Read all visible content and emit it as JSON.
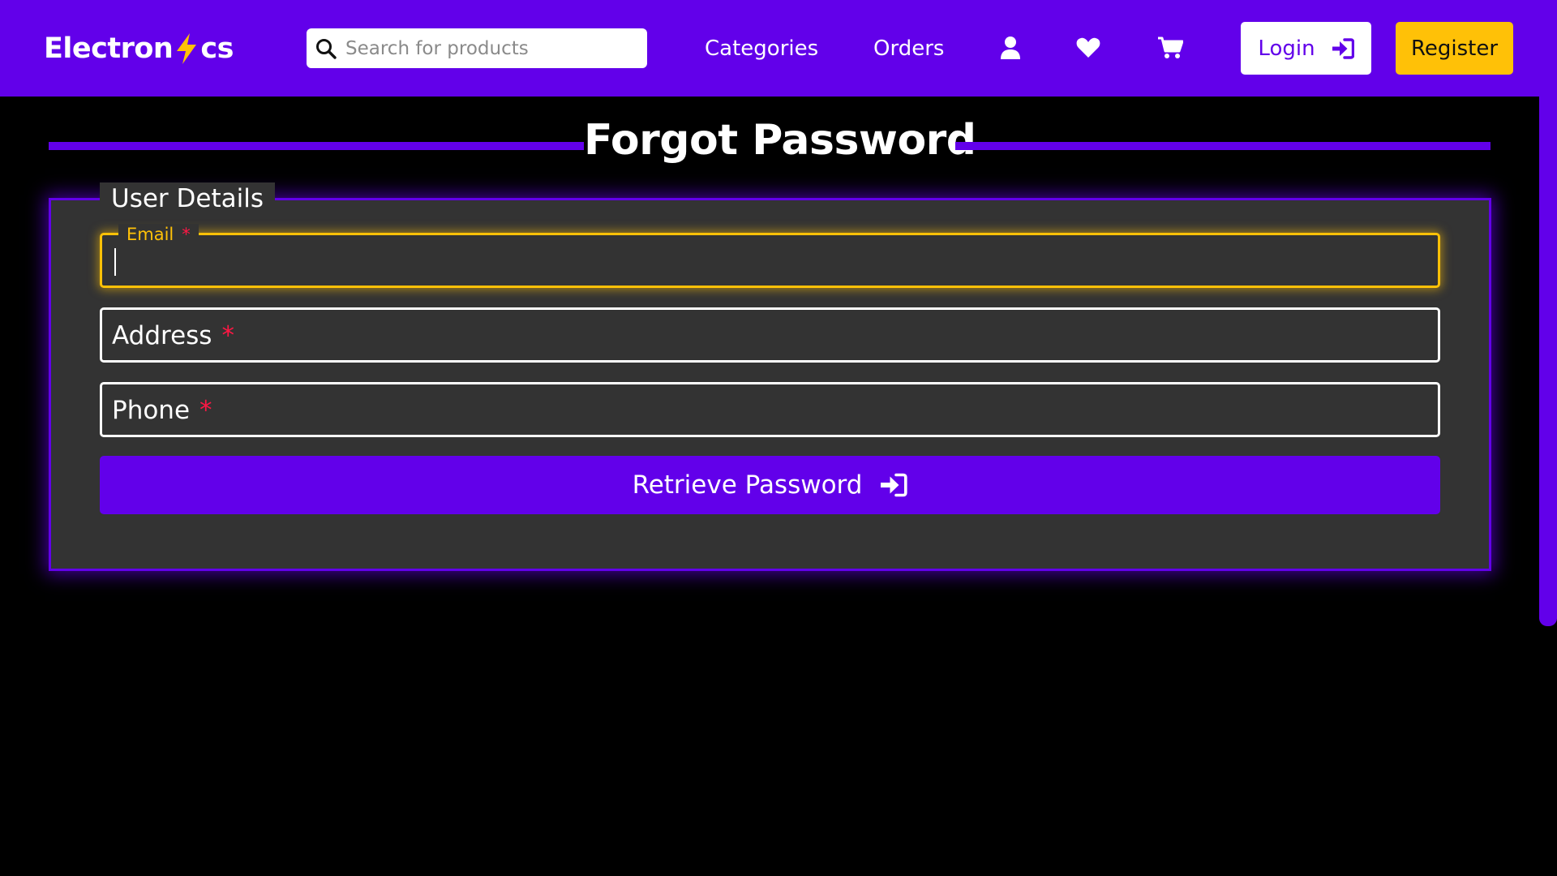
{
  "header": {
    "logo": {
      "text_before": "Electron",
      "icon": "lightning-bolt-icon",
      "text_after": "cs"
    },
    "search": {
      "placeholder": "Search for products",
      "value": "",
      "icon": "search-icon"
    },
    "nav": {
      "categories_label": "Categories",
      "orders_label": "Orders",
      "profile_icon": "user-icon",
      "wishlist_icon": "heart-icon",
      "cart_icon": "cart-icon"
    },
    "login_label": "Login",
    "login_icon": "sign-in-icon",
    "register_label": "Register"
  },
  "page": {
    "title": "Forgot Password"
  },
  "form": {
    "legend": "User Details",
    "fields": [
      {
        "label": "Email",
        "required_mark": "*",
        "value": "",
        "focused": true
      },
      {
        "label": "Address",
        "required_mark": "*",
        "value": "",
        "focused": false
      },
      {
        "label": "Phone",
        "required_mark": "*",
        "value": "",
        "focused": false
      }
    ],
    "submit_label": "Retrieve Password",
    "submit_icon": "sign-in-icon"
  },
  "colors": {
    "brand": "#6200ea",
    "accent": "#ffc107",
    "required": "#ff1744",
    "panel_bg": "#333333",
    "page_bg": "#000000"
  }
}
